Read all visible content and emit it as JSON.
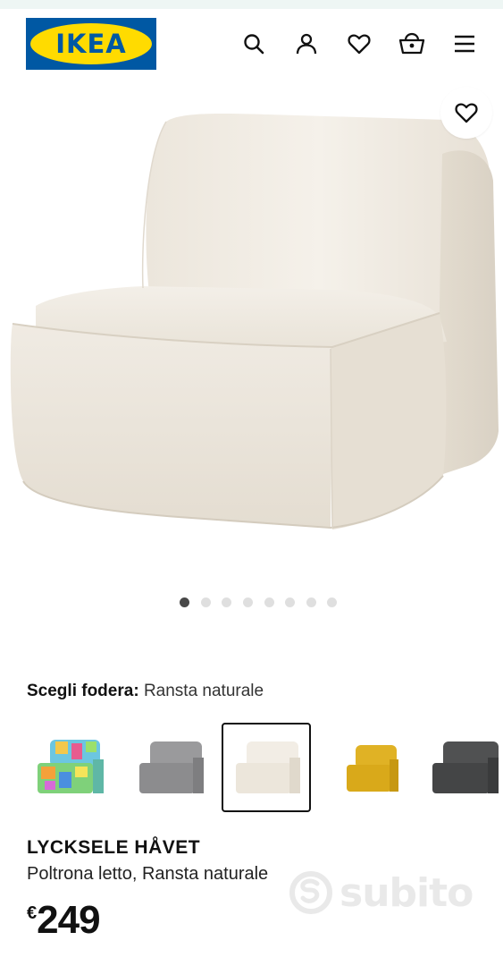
{
  "brand": {
    "logo_text": "IKEA",
    "colors": {
      "blue": "#0058a3",
      "yellow": "#ffdb00"
    }
  },
  "header": {
    "icons": [
      "search-icon",
      "account-icon",
      "favourites-icon",
      "basket-icon",
      "menu-icon"
    ]
  },
  "gallery": {
    "image_count": 8,
    "active_index": 0
  },
  "cover": {
    "label": "Scegli fodera:",
    "value": "Ransta naturale",
    "swatches": [
      {
        "color": "multicolor",
        "selected": false
      },
      {
        "color": "#8c8c8e",
        "selected": false
      },
      {
        "color": "#ece6db",
        "selected": true
      },
      {
        "color": "#d9a91a",
        "selected": false
      },
      {
        "color": "#444546",
        "selected": false
      }
    ]
  },
  "product": {
    "name": "LYCKSELE HÅVET",
    "description": "Poltrona letto, Ransta naturale",
    "currency": "€",
    "price": "249"
  },
  "watermark": {
    "text": "subito"
  }
}
